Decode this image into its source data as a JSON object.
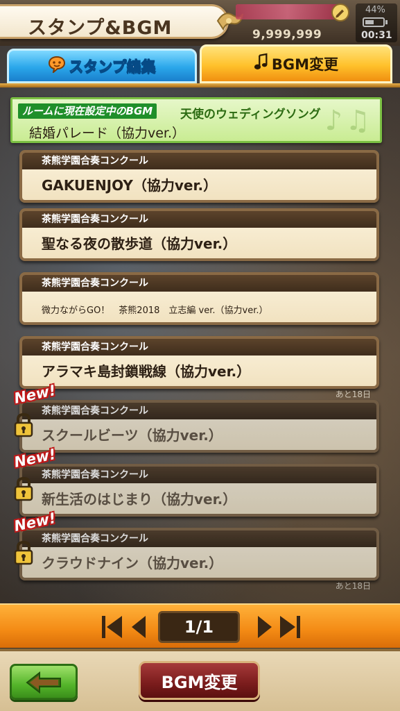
{
  "header": {
    "title": "スタンプ&BGM",
    "money_label": "",
    "money": "9,999,999",
    "battery": "44%",
    "clock": "00:31"
  },
  "tabs": [
    {
      "label": "スタンプ編集",
      "active": false,
      "icon": "speech-bubble-icon"
    },
    {
      "label": "BGM変更",
      "active": true,
      "icon": "music-note-icon"
    }
  ],
  "current_bgm": {
    "label": "ルームに現在設定中のBGM",
    "title": "天使のウェディングソング",
    "value": "結婚パレード（協力ver.）"
  },
  "list": {
    "items": [
      {
        "category": "茶熊学園合奏コンクール",
        "title": "GAKUENJOY（協力ver.）",
        "locked": false,
        "new": false
      },
      {
        "category": "茶熊学園合奏コンクール",
        "title": "聖なる夜の散歩道（協力ver.）",
        "locked": false,
        "new": false
      },
      {
        "category": "茶熊学園合奏コンクール",
        "title": "微力ながらGO！　茶熊2018　立志編 ver.（協力ver.）",
        "locked": false,
        "new": false
      },
      {
        "category": "茶熊学園合奏コンクール",
        "title": "アラマキ島封鎖戦線（協力ver.）",
        "locked": false,
        "new": false,
        "days_left": "あと18日"
      },
      {
        "category": "茶熊学園合奏コンクール",
        "title": "スクールビーツ（協力ver.）",
        "locked": true,
        "new": true
      },
      {
        "category": "茶熊学園合奏コンクール",
        "title": "新生活のはじまり（協力ver.）",
        "locked": true,
        "new": true
      },
      {
        "category": "茶熊学園合奏コンクール",
        "title": "クラウドナイン（協力ver.）",
        "locked": true,
        "new": true,
        "days_left": "あと18日"
      }
    ],
    "new_badge": "New!"
  },
  "pager": {
    "page": "1/1"
  },
  "footer": {
    "change_label": "BGM変更"
  },
  "colors": {
    "tab_active": "#ffc12b",
    "tab_inactive": "#2aa7ea",
    "current_bgm_bg": "#c9ec93",
    "pager_bg": "#f38a14",
    "back_button": "#54b42a",
    "change_button": "#7a1c1c"
  }
}
